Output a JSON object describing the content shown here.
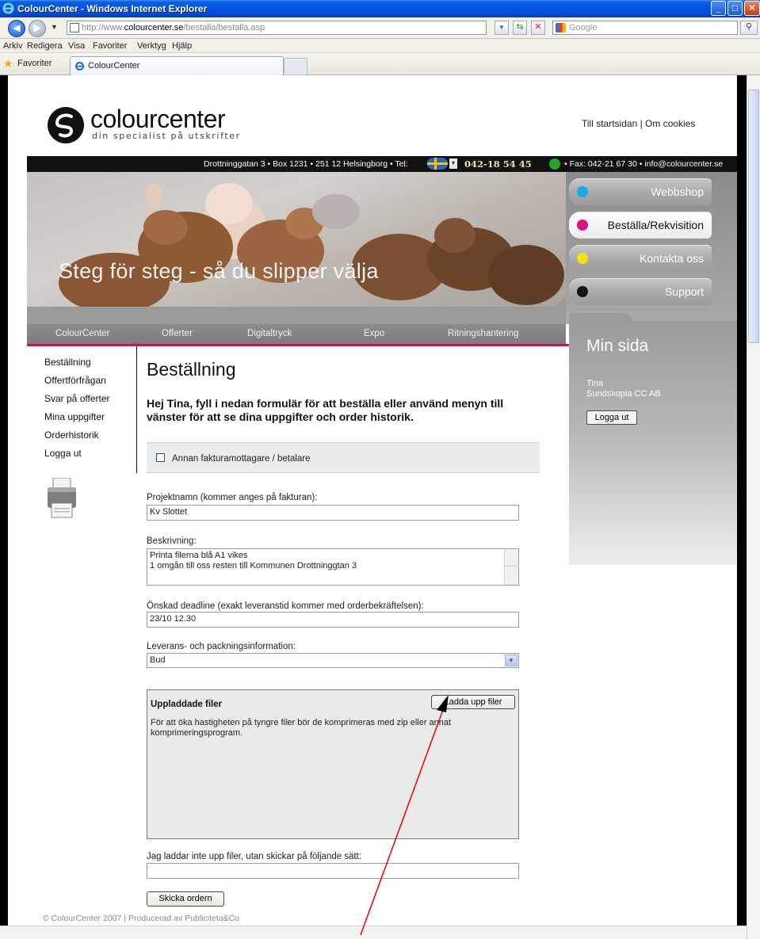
{
  "window": {
    "title": "ColourCenter - Windows Internet Explorer",
    "url_prefix": "http://www.",
    "url_domain": "colourcenter.se",
    "url_path": "/bestalla/bestalla.asp",
    "search_placeholder": "Google"
  },
  "menubar": [
    "Arkiv",
    "Redigera",
    "Visa",
    "Favoriter",
    "Verktyg",
    "Hjälp"
  ],
  "favorites": {
    "label": "Favoriter",
    "tab_title": "ColourCenter"
  },
  "site": {
    "logo_word": "colourcenter",
    "logo_tagline": "din specialist på utskrifter",
    "top_links": "Till startsidan | Om cookies",
    "address": "Drottninggatan 3 • Box 1231 • 251 12 Helsingborg • Tel:",
    "phone": "042-18 54 45",
    "fax_email": "• Fax: 042-21 67 30 • info@colourcenter.se",
    "hero_tagline": "Steg för steg - så du slipper välja",
    "side_buttons": [
      {
        "label": "Webbshop",
        "dot": "#1aa8e8"
      },
      {
        "label": "Beställa/Rekvisition",
        "dot": "#e0137c"
      },
      {
        "label": "Kontakta oss",
        "dot": "#f5e10f"
      },
      {
        "label": "Support",
        "dot": "#111111"
      }
    ],
    "nav": [
      "ColourCenter",
      "Offerter",
      "Digitaltryck",
      "Expo",
      "Ritningshantering"
    ],
    "accent_color": "#d10e6a"
  },
  "left_menu": [
    "Beställning",
    "Offertförfrågan",
    "Svar på offerter",
    "Mina uppgifter",
    "Orderhistorik",
    "Logga ut"
  ],
  "my_page": {
    "title": "Min sida",
    "user_name": "Tina",
    "company": "Sundskopia CC AB",
    "logout_label": "Logga ut"
  },
  "form": {
    "title": "Beställning",
    "intro": "Hej Tina, fyll i nedan formulär för att beställa eller använd menyn till vänster för att se dina uppgifter och order historik.",
    "other_payer_label": "Annan fakturamottagare / betalare",
    "other_payer_checked": false,
    "project_label": "Projektnamn (kommer anges på fakturan):",
    "project_value": "Kv Slottet",
    "description_label": "Beskrivning:",
    "description_value": "Printa filerna blå A1 vikes\n1 omgån till oss resten till Kommunen Drottninggtan 3",
    "deadline_label": "Önskad deadline (exakt leveranstid kommer med orderbekräftelsen):",
    "deadline_value": "23/10 12.30",
    "delivery_label": "Leverans- och packningsinformation:",
    "delivery_value": "Bud",
    "uploads_title": "Uppladdade filer",
    "upload_button": "Ladda upp filer",
    "upload_note": "För att öka hastigheten på tyngre filer bör de komprimeras med zip eller annat komprimeringsprogram.",
    "no_upload_label": "Jag laddar inte upp filer, utan skickar på följande sätt:",
    "no_upload_value": "",
    "submit_label": "Skicka ordern"
  },
  "footer": "© ColourCenter 2007 | Producerad av Publiciteta&Co"
}
